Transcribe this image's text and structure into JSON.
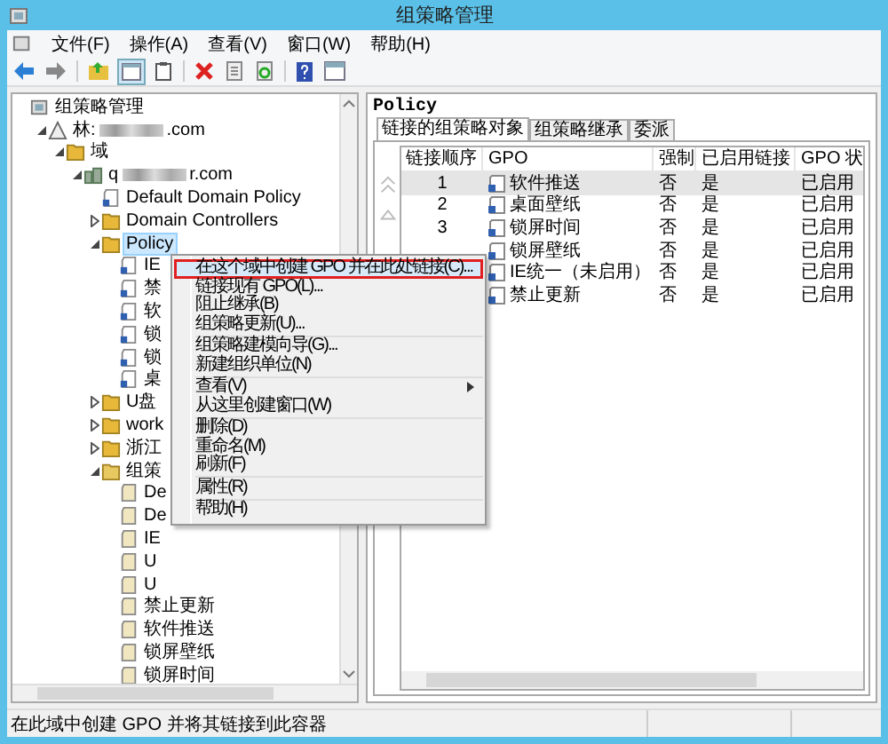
{
  "window": {
    "title": "组策略管理"
  },
  "menu": [
    "文件(F)",
    "操作(A)",
    "查看(V)",
    "窗口(W)",
    "帮助(H)"
  ],
  "tree": [
    {
      "label": "组策略管理",
      "kind": "console",
      "children": [
        {
          "label": "林:",
          "suffix": ".com",
          "kind": "forest",
          "expanded": true,
          "children": [
            {
              "label": "域",
              "kind": "domains",
              "expanded": true,
              "children": [
                {
                  "label": "q",
                  "suffix": "r.com",
                  "kind": "domain",
                  "expanded": true,
                  "children": [
                    {
                      "label": "Default Domain Policy",
                      "kind": "gpo-link"
                    },
                    {
                      "label": "Domain Controllers",
                      "kind": "ou",
                      "expanded": false
                    },
                    {
                      "label": "Policy",
                      "kind": "ou",
                      "expanded": true,
                      "selected": true,
                      "children": [
                        {
                          "label": "IE",
                          "kind": "gpo-link"
                        },
                        {
                          "label": "禁",
                          "kind": "gpo-link"
                        },
                        {
                          "label": "软",
                          "kind": "gpo-link"
                        },
                        {
                          "label": "锁",
                          "kind": "gpo-link"
                        },
                        {
                          "label": "锁",
                          "kind": "gpo-link"
                        },
                        {
                          "label": "桌",
                          "kind": "gpo-link"
                        }
                      ]
                    },
                    {
                      "label": "U盘",
                      "kind": "ou",
                      "expanded": false
                    },
                    {
                      "label": "work",
                      "kind": "ou",
                      "expanded": false
                    },
                    {
                      "label": "浙江",
                      "kind": "ou",
                      "expanded": false
                    },
                    {
                      "label": "组策",
                      "kind": "gpo-folder",
                      "expanded": true,
                      "children": [
                        {
                          "label": "De",
                          "kind": "gpo"
                        },
                        {
                          "label": "De",
                          "kind": "gpo"
                        },
                        {
                          "label": "IE",
                          "kind": "gpo"
                        },
                        {
                          "label": "U",
                          "kind": "gpo"
                        },
                        {
                          "label": "U",
                          "kind": "gpo"
                        },
                        {
                          "label": "禁止更新",
                          "kind": "gpo"
                        },
                        {
                          "label": "软件推送",
                          "kind": "gpo"
                        },
                        {
                          "label": "锁屏壁纸",
                          "kind": "gpo"
                        },
                        {
                          "label": "锁屏时间",
                          "kind": "gpo"
                        }
                      ]
                    }
                  ]
                }
              ]
            }
          ]
        }
      ]
    }
  ],
  "detail": {
    "title": "Policy",
    "tabs": [
      {
        "label": "链接的组策略对象",
        "selected": true
      },
      {
        "label": "组策略继承",
        "selected": false
      },
      {
        "label": "委派",
        "selected": false
      }
    ],
    "columns": [
      "链接顺序",
      "GPO",
      "强制",
      "已启用链接",
      "GPO 状"
    ],
    "rows": [
      {
        "order": "1",
        "gpo": "软件推送",
        "enforced": "否",
        "enabled": "是",
        "status": "已启用",
        "selected": true
      },
      {
        "order": "2",
        "gpo": "桌面壁纸",
        "enforced": "否",
        "enabled": "是",
        "status": "已启用",
        "selected": false
      },
      {
        "order": "3",
        "gpo": "锁屏时间",
        "enforced": "否",
        "enabled": "是",
        "status": "已启用",
        "selected": false
      },
      {
        "gpo": "锁屏壁纸",
        "enforced": "否",
        "enabled": "是",
        "status": "已启用",
        "selected": false
      },
      {
        "gpo": "IE统一（未启用）",
        "enforced": "否",
        "enabled": "是",
        "status": "已启用",
        "selected": false
      },
      {
        "gpo": "禁止更新",
        "enforced": "否",
        "enabled": "是",
        "status": "已启用",
        "selected": false
      }
    ]
  },
  "context_menu": [
    [
      {
        "label": "在这个域中创建 GPO 并在此处链接(C)...",
        "selected": true,
        "submenu": false
      },
      {
        "label": "链接现有 GPO(L)...",
        "selected": false,
        "submenu": false
      },
      {
        "label": "阻止继承(B)",
        "selected": false,
        "submenu": false
      },
      {
        "label": "组策略更新(U)...",
        "selected": false,
        "submenu": false
      }
    ],
    [
      {
        "label": "组策略建模向导(G)...",
        "selected": false,
        "submenu": false
      },
      {
        "label": "新建组织单位(N)",
        "selected": false,
        "submenu": false
      }
    ],
    [
      {
        "label": "查看(V)",
        "selected": false,
        "submenu": true
      },
      {
        "label": "从这里创建窗口(W)",
        "selected": false,
        "submenu": false
      }
    ],
    [
      {
        "label": "删除(D)",
        "selected": false,
        "submenu": false
      },
      {
        "label": "重命名(M)",
        "selected": false,
        "submenu": false
      },
      {
        "label": "刷新(F)",
        "selected": false,
        "submenu": false
      }
    ],
    [
      {
        "label": "属性(R)",
        "selected": false,
        "submenu": false
      }
    ],
    [
      {
        "label": "帮助(H)",
        "selected": false,
        "submenu": false
      }
    ]
  ],
  "status_bar": "在此域中创建 GPO 并将其链接到此容器"
}
